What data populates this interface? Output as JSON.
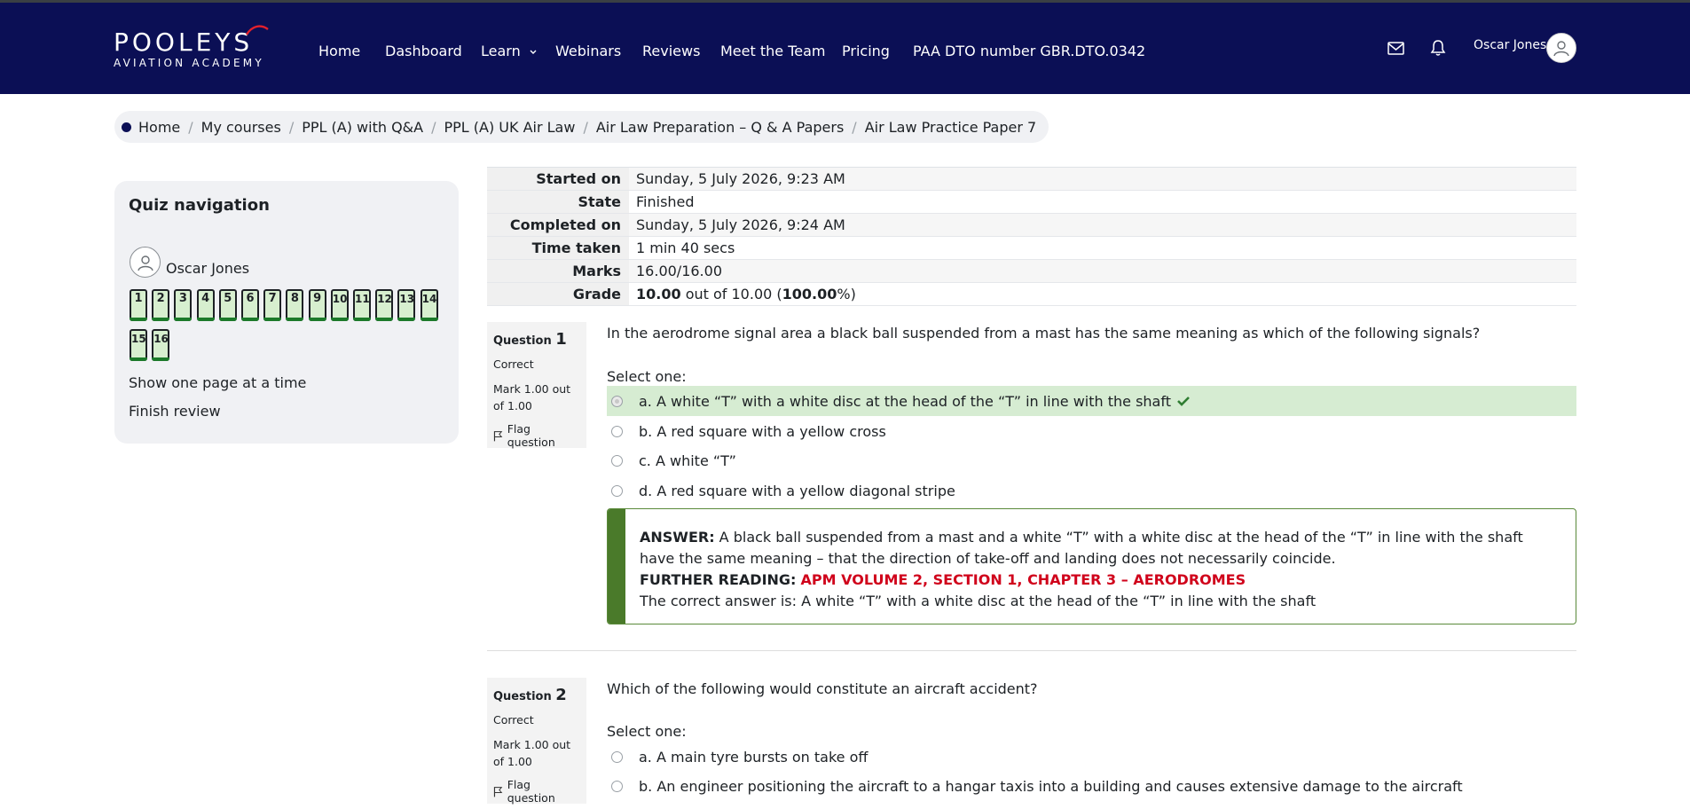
{
  "brand": {
    "line1": "POOLEYS",
    "line2": "AVIATION ACADEMY"
  },
  "nav": {
    "home": "Home",
    "dashboard": "Dashboard",
    "learn": "Learn",
    "webinars": "Webinars",
    "reviews": "Reviews",
    "team": "Meet the Team",
    "pricing": "Pricing",
    "dto": "PAA DTO number GBR.DTO.0342",
    "user": "Oscar Jones"
  },
  "breadcrumb": [
    "Home",
    "My courses",
    "PPL (A) with Q&A",
    "PPL (A) UK Air Law",
    "Air Law Preparation – Q & A Papers",
    "Air Law Practice Paper 7"
  ],
  "quiz_nav": {
    "title": "Quiz navigation",
    "user": "Oscar Jones",
    "buttons": [
      "1",
      "2",
      "3",
      "4",
      "5",
      "6",
      "7",
      "8",
      "9",
      "10",
      "11",
      "12",
      "13",
      "14",
      "15",
      "16"
    ],
    "show_one_page": "Show one page at a time",
    "finish_review": "Finish review"
  },
  "summary": {
    "started_label": "Started on",
    "started_value": "Sunday, 5 July 2026, 9:23 AM",
    "state_label": "State",
    "state_value": "Finished",
    "completed_label": "Completed on",
    "completed_value": "Sunday, 5 July 2026, 9:24 AM",
    "time_label": "Time taken",
    "time_value": "1 min 40 secs",
    "marks_label": "Marks",
    "marks_value": "16.00/16.00",
    "grade_label": "Grade",
    "grade_score": "10.00",
    "grade_mid": " out of 10.00 (",
    "grade_pct": "100.00",
    "grade_end": "%)"
  },
  "q1": {
    "label": "Question",
    "number": "1",
    "status": "Correct",
    "mark": "Mark 1.00 out of 1.00",
    "flag": "Flag question",
    "text": "In the aerodrome signal area a black ball suspended from a mast has the same meaning as which of the following signals?",
    "select": "Select one:",
    "options": [
      "a. A white “T” with a white disc at the head of the “T” in line with the shaft",
      "b. A red square with a yellow cross",
      "c. A white “T”",
      "d. A red square with a yellow diagonal stripe"
    ],
    "answer_label": "ANSWER:",
    "answer_text": " A black ball suspended from a mast and a white “T” with a white disc at the head of the “T” in line with the shaft have the same meaning – that the direction of take-off and landing does not necessarily coincide.",
    "further_label": "FURTHER READING:",
    "further_text": "APM VOLUME 2, SECTION 1, CHAPTER 3 – AERODROMES",
    "correct_answer": "The correct answer is: A white “T” with a white disc at the head of the “T” in line with the shaft"
  },
  "q2": {
    "label": "Question",
    "number": "2",
    "status": "Correct",
    "mark": "Mark 1.00 out of 1.00",
    "flag": "Flag question",
    "text": "Which of the following would constitute an aircraft accident?",
    "select": "Select one:",
    "options": [
      "a. A main tyre bursts on take off",
      "b. An engineer positioning the aircraft to a hangar taxis into a building and causes extensive damage to the aircraft"
    ]
  },
  "colors": {
    "navbar": "#0b0f55",
    "correct_bg": "#d6ecd2",
    "feedback_bar": "#4a7a2a",
    "reading_red": "#d0021b"
  }
}
